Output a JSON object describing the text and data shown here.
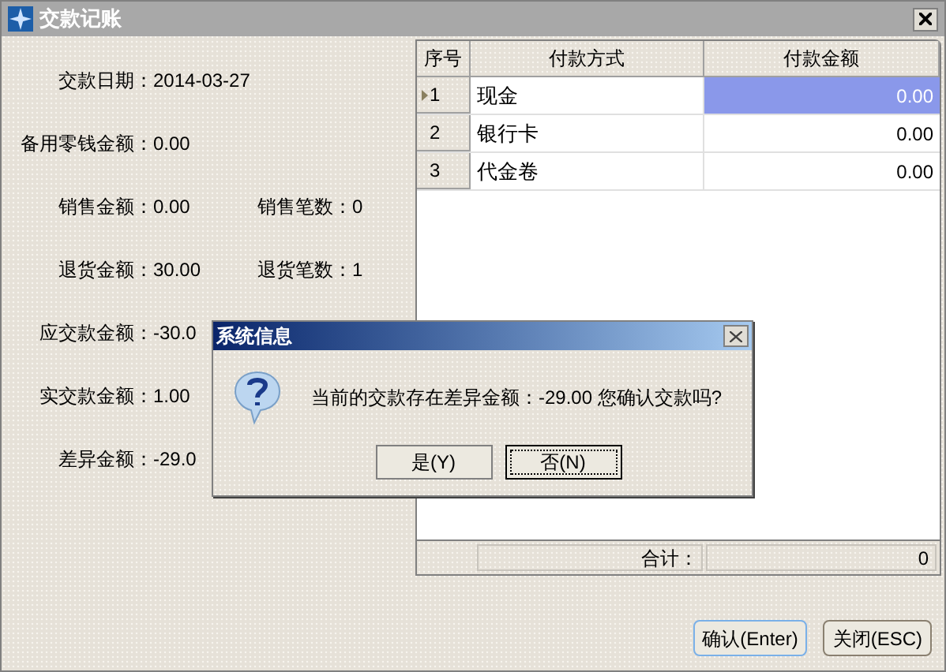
{
  "window": {
    "title": "交款记账"
  },
  "fields": [
    {
      "label": "交款日期：",
      "value": "2014-03-27"
    },
    {
      "label": "备用零钱金额：",
      "value": "0.00"
    },
    {
      "label": "销售金额：",
      "value": "0.00",
      "extra_label": "销售笔数：",
      "extra_value": "0"
    },
    {
      "label": "退货金额：",
      "value": "30.00",
      "extra_label": "退货笔数：",
      "extra_value": "1"
    },
    {
      "label": "应交款金额：",
      "value": "-30.0"
    },
    {
      "label": "实交款金额：",
      "value": "1.00"
    },
    {
      "label": "差异金额：",
      "value": "-29.0"
    }
  ],
  "table": {
    "columns": [
      "序号",
      "付款方式",
      "付款金额"
    ],
    "rows": [
      {
        "index": "1",
        "method": "现金",
        "amount": "0.00",
        "selected": true
      },
      {
        "index": "2",
        "method": "银行卡",
        "amount": "0.00",
        "selected": false
      },
      {
        "index": "3",
        "method": "代金卷",
        "amount": "0.00",
        "selected": false
      }
    ]
  },
  "total": {
    "label": "合计：",
    "value": "0"
  },
  "buttons": [
    "确认(Enter)",
    "关闭(ESC)"
  ],
  "dialog": {
    "title": "系统信息",
    "message": "当前的交款存在差异金额：-29.00 您确认交款吗?",
    "buttons": [
      {
        "label": "是(Y)",
        "focused": false
      },
      {
        "label": "否(N)",
        "focused": true
      }
    ]
  }
}
